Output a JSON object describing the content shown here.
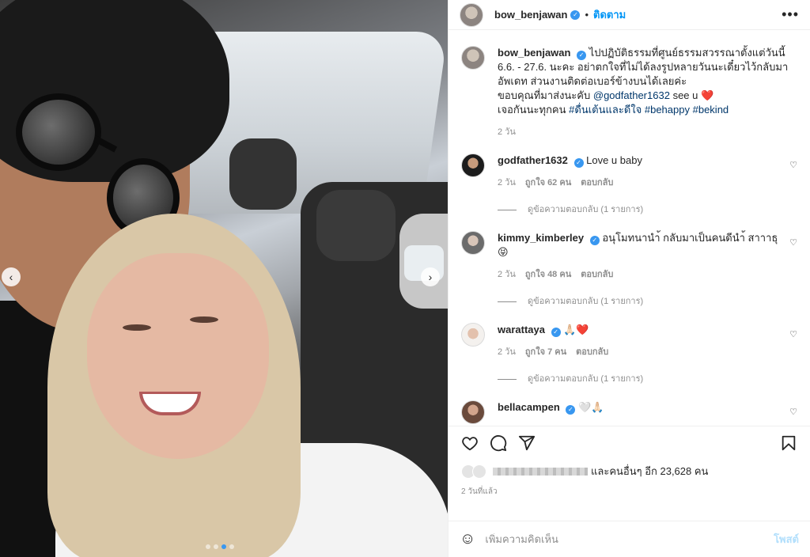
{
  "post": {
    "slide_count": 4,
    "active_slide": 3
  },
  "header": {
    "username": "bow_benjawan",
    "follow_label": "ติดตาม",
    "more_label": "•••"
  },
  "caption": {
    "username": "bow_benjawan",
    "line1": "ไปปฏิบัติธรรมที่ศูนย์ธรรมสวรรณาตั้งแต่วันนี้ 6.6. - 27.6. นะคะ อย่าตกใจที่ไม่ได้ลงรูปหลายวันนะเดี๋ยวไว้กลับมาอัพเดท ส่วนงานติดต่อเบอร์ข้างบนได้เลยค่ะ",
    "line2_prefix": "ขอบคุณที่มาส่งนะคับ",
    "mention": "@godfather1632",
    "line2_suffix": "see u",
    "line2_emoji": "❤️",
    "line3_prefix": "เจอกันนะทุกคน",
    "hashtags": [
      "#ดื่นเต้นและดีใจ",
      "#behappy",
      "#bekind"
    ],
    "time": "2 วัน"
  },
  "comments": [
    {
      "username": "godfather1632",
      "text": "Love u baby",
      "time": "2 วัน",
      "likes": "ถูกใจ 62 คน",
      "reply": "ตอบกลับ",
      "replies": "ดูข้อความตอบกลับ (1 รายการ)"
    },
    {
      "username": "kimmy_kimberley",
      "text": "อนุโมทนานำ้ กลับมาเป็นคนดีนำ้ สาาาธุ",
      "emoji": "😝",
      "time": "2 วัน",
      "likes": "ถูกใจ 48 คน",
      "reply": "ตอบกลับ",
      "replies": "ดูข้อความตอบกลับ (1 รายการ)"
    },
    {
      "username": "warattaya",
      "text": "🙏🏻❤️",
      "time": "2 วัน",
      "likes": "ถูกใจ 7 คน",
      "reply": "ตอบกลับ",
      "replies": "ดูข้อความตอบกลับ (1 รายการ)"
    },
    {
      "username": "bellacampen",
      "text": "🤍🙏🏻"
    }
  ],
  "actions": {
    "likes_text": "และคนอื่นๆ อีก 23,628 คน",
    "post_time": "2 วันที่แล้ว"
  },
  "add_comment": {
    "placeholder": "เพิ่มความคิดเห็น",
    "post_label": "โพสต์",
    "emoji_icon": "☺"
  },
  "icons": {
    "verified": "✓",
    "heart": "♡",
    "prev": "‹",
    "next": "›"
  }
}
